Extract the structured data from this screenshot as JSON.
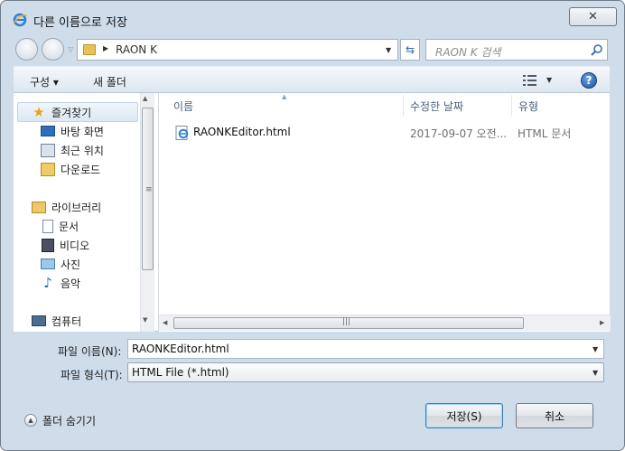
{
  "window": {
    "title": "다른 이름으로 저장",
    "close_label": "✕"
  },
  "nav": {
    "address_text": "RAON K",
    "search_placeholder": "RAON K 검색"
  },
  "toolbar": {
    "organize_label": "구성 ▾",
    "new_folder_label": "새 폴더"
  },
  "sidebar": {
    "favorites_label": "즐겨찾기",
    "favorites": [
      "바탕 화면",
      "최근 위치",
      "다운로드"
    ],
    "library_label": "라이브러리",
    "libraries": [
      "문서",
      "비디오",
      "사진",
      "음악"
    ],
    "computer_label": "컴퓨터"
  },
  "file_list": {
    "columns": [
      "이름",
      "수정한 날짜",
      "유형"
    ],
    "rows": [
      {
        "name": "RAONKEditor.html",
        "modified": "2017-09-07 오전...",
        "type": "HTML 문서"
      }
    ]
  },
  "form": {
    "filename_label": "파일 이름(N):",
    "filename_value": "RAONKEditor.html",
    "filetype_label": "파일 형식(T):",
    "filetype_value": "HTML File (*.html)"
  },
  "footer": {
    "hide_folders_label": "폴더 숨기기",
    "save_label": "저장(S)",
    "cancel_label": "취소"
  },
  "colors": {
    "frame": "#cfdcea",
    "accent": "#2f6bb7",
    "favorites_star": "#e9a417"
  }
}
